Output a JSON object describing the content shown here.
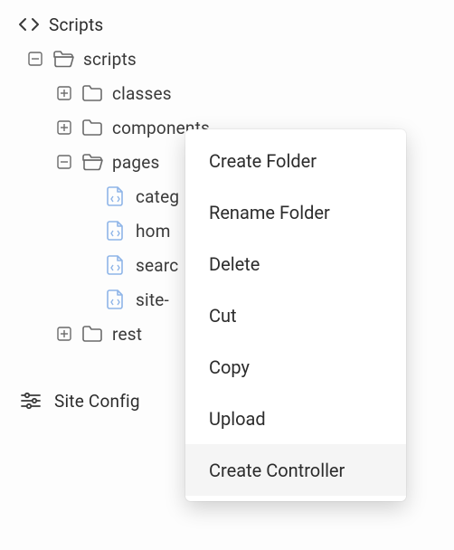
{
  "header": {
    "title": "Scripts"
  },
  "tree": {
    "root": {
      "label": "scripts",
      "children": [
        {
          "label": "classes",
          "type": "folder-closed"
        },
        {
          "label": "components",
          "type": "folder-closed"
        },
        {
          "label": "pages",
          "type": "folder-open",
          "children": [
            {
              "label": "categ"
            },
            {
              "label": "hom"
            },
            {
              "label": "searc"
            },
            {
              "label": "site-"
            }
          ]
        },
        {
          "label": "rest",
          "type": "folder-closed"
        }
      ]
    }
  },
  "siteConfig": {
    "label": "Site Config"
  },
  "contextMenu": {
    "items": [
      {
        "label": "Create Folder"
      },
      {
        "label": "Rename Folder"
      },
      {
        "label": "Delete"
      },
      {
        "label": "Cut"
      },
      {
        "label": "Copy"
      },
      {
        "label": "Upload"
      },
      {
        "label": "Create Controller"
      }
    ]
  }
}
